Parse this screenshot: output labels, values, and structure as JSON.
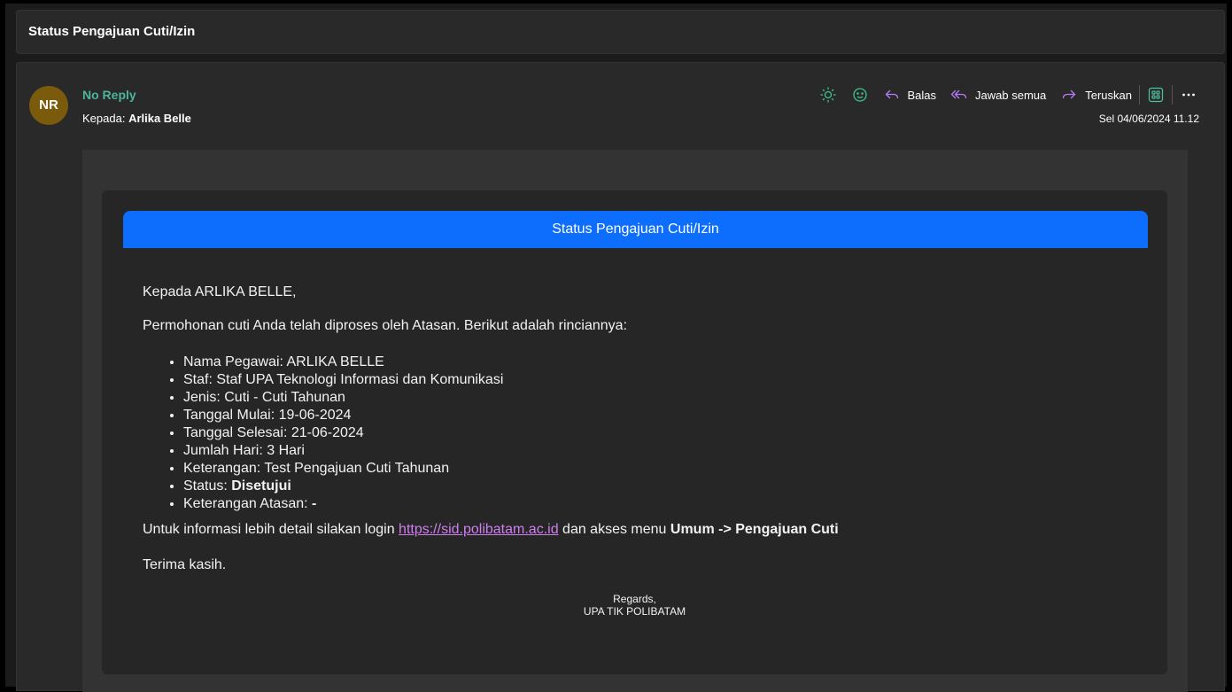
{
  "subject": "Status Pengajuan Cuti/Izin",
  "sender": {
    "initials": "NR",
    "name": "No Reply",
    "to_label": "Kepada:",
    "to_name": "Arlika Belle",
    "date": "Sel 04/06/2024 11.12",
    "avatar_color": "#7a5a0b",
    "name_color": "#4cb59a"
  },
  "actions": {
    "reply": "Balas",
    "reply_all": "Jawab semua",
    "forward": "Teruskan"
  },
  "icons": [
    "brightness-icon",
    "emoji-icon",
    "reply-icon",
    "reply-all-icon",
    "forward-icon",
    "apps-icon",
    "more-icon"
  ],
  "email": {
    "banner": "Status Pengajuan Cuti/Izin",
    "banner_color": "#0d6efd",
    "greeting": "Kepada ARLIKA BELLE,",
    "intro": "Permohonan cuti Anda telah diproses oleh Atasan. Berikut adalah rinciannya:",
    "details": [
      "Nama Pegawai: ARLIKA BELLE",
      "Staf: Staf UPA Teknologi Informasi dan Komunikasi",
      "Jenis: Cuti - Cuti Tahunan",
      "Tanggal Mulai: 19-06-2024",
      "Tanggal Selesai: 21-06-2024",
      "Jumlah Hari: 3 Hari",
      "Keterangan: Test Pengajuan Cuti Tahunan"
    ],
    "status_label": "Status: ",
    "status_value": "Disetujui",
    "manager_note_label": "Keterangan Atasan: ",
    "manager_note_value": "-",
    "info_prefix": "Untuk informasi lebih detail silakan login ",
    "info_link": "https://sid.polibatam.ac.id",
    "info_middle": " dan akses menu ",
    "info_menu": "Umum -> Pengajuan Cuti",
    "thanks": "Terima kasih.",
    "regards": "Regards,",
    "org": "UPA TIK POLIBATAM"
  }
}
